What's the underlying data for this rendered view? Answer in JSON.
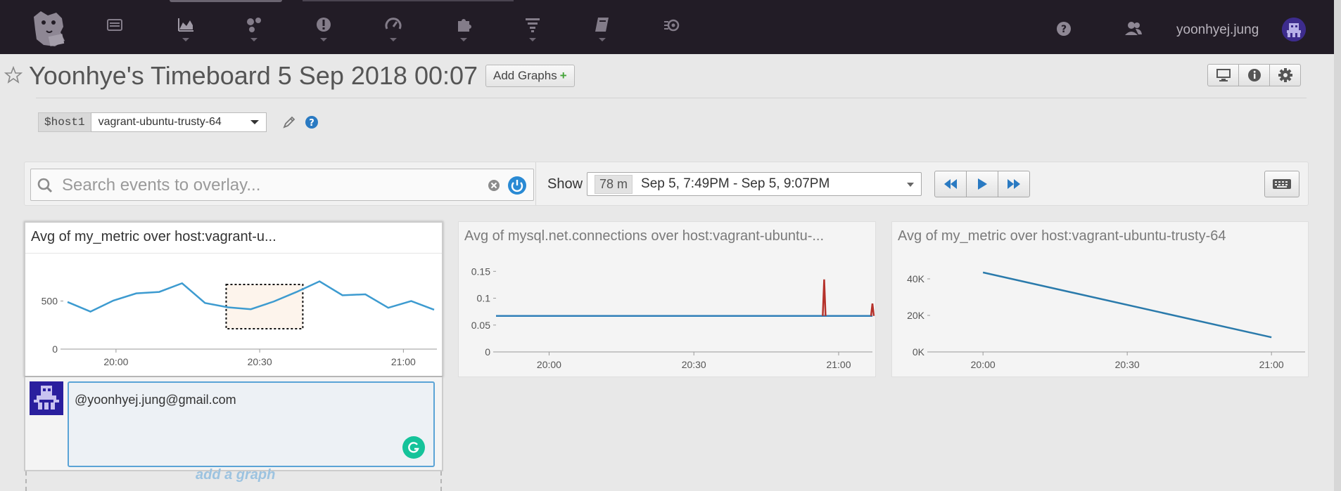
{
  "nav": {
    "username": "yoonhyej.jung",
    "icons": [
      "dashboard-logo-icon",
      "events-icon",
      "metrics-icon",
      "infrastructure-icon",
      "monitors-icon",
      "apm-icon",
      "integrations-icon",
      "logs-icon",
      "notebooks-icon",
      "watchdog-icon",
      "help-icon",
      "team-icon",
      "user-avatar-icon"
    ]
  },
  "header": {
    "title": "Yoonhye's Timeboard 5 Sep 2018 00:07",
    "add_graphs_label": "Add Graphs",
    "add_graphs_plus": "+",
    "template_var_name": "$host1",
    "template_var_value": "vagrant-ubuntu-trusty-64"
  },
  "controls": {
    "search_placeholder": "Search events to overlay...",
    "show_label": "Show",
    "duration": "78 m",
    "time_range": "Sep 5, 7:49PM - Sep 5, 9:07PM"
  },
  "graphs": [
    {
      "title": "Avg of my_metric over host:vagrant-u..."
    },
    {
      "title": "Avg of mysql.net.connections over host:vagrant-ubuntu-..."
    },
    {
      "title": "Avg of my_metric over host:vagrant-ubuntu-trusty-64"
    }
  ],
  "chart_data": [
    {
      "type": "line",
      "title": "Avg of my_metric over host:vagrant-u...",
      "x": [
        "19:49",
        "19:53",
        "19:57",
        "20:01",
        "20:05",
        "20:09",
        "20:13",
        "20:17",
        "20:21",
        "20:25",
        "20:29",
        "20:33",
        "20:37",
        "20:41",
        "20:45",
        "20:49",
        "20:53",
        "20:57",
        "21:01",
        "21:05",
        "21:07"
      ],
      "x_tick_labels": [
        "20:00",
        "20:30",
        "21:00"
      ],
      "y_tick_labels": [
        "0",
        "500"
      ],
      "ylim": [
        0,
        950
      ],
      "series": [
        {
          "values": [
            490,
            390,
            505,
            580,
            595,
            685,
            480,
            435,
            415,
            495,
            595,
            705,
            560,
            570,
            430,
            500,
            410
          ]
        }
      ],
      "selection": {
        "from": "20:23",
        "to": "20:39"
      },
      "color": "#3d9bd0"
    },
    {
      "type": "line",
      "title": "Avg of mysql.net.connections over host:vagrant-ubuntu-...",
      "x_tick_labels": [
        "20:00",
        "20:30",
        "21:00"
      ],
      "y_tick_labels": [
        "0",
        "0.05",
        "0.1",
        "0.15"
      ],
      "ylim": [
        0,
        0.17
      ],
      "series": [
        {
          "values": [
            0.067,
            0.067,
            0.067,
            0.067,
            0.067,
            0.067,
            0.067,
            0.067,
            0.067,
            0.067
          ],
          "color": "#2f7fb8"
        },
        {
          "spikes": [
            {
              "x": "20:57",
              "y": 0.135
            },
            {
              "x": "21:07",
              "y": 0.09
            }
          ],
          "color": "#b5322b"
        }
      ]
    },
    {
      "type": "line",
      "title": "Avg of my_metric over host:vagrant-ubuntu-trusty-64",
      "x_tick_labels": [
        "20:00",
        "20:30",
        "21:00"
      ],
      "y_tick_labels": [
        "0K",
        "20K",
        "40K"
      ],
      "ylim": [
        0,
        50000
      ],
      "series": [
        {
          "x": [
            "20:00",
            "21:00"
          ],
          "values": [
            43500,
            8000
          ]
        }
      ],
      "color": "#2a7aab"
    }
  ],
  "comment": {
    "text": "@yoonhyej.jung@gmail.com"
  },
  "add_graph_label": "add a graph"
}
